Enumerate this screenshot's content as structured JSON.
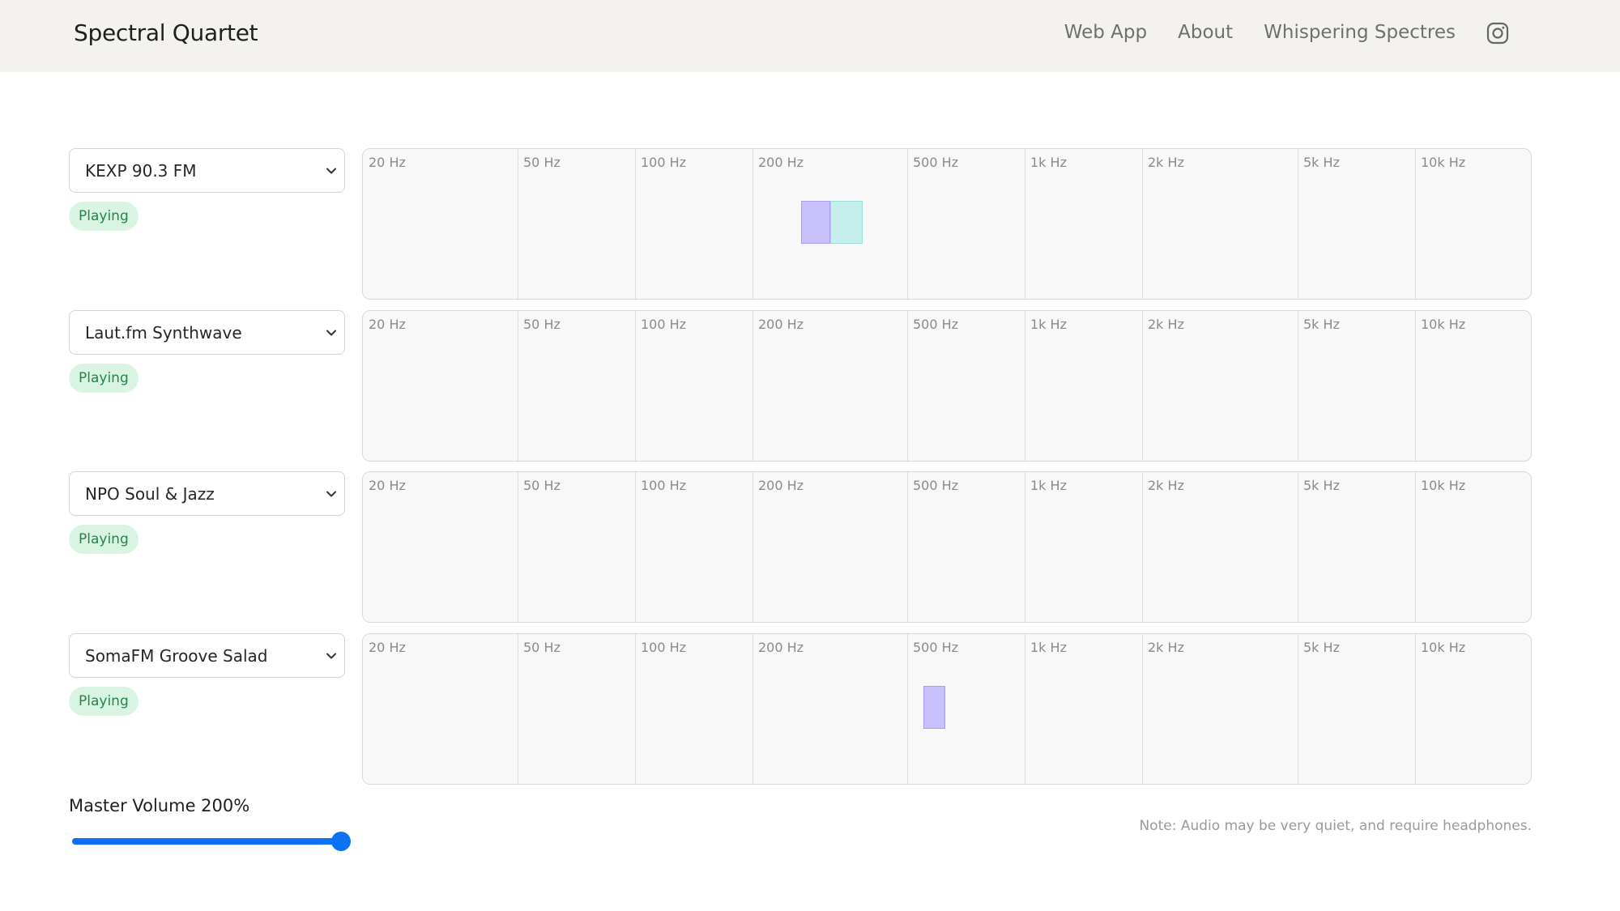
{
  "header": {
    "brand": "Spectral Quartet",
    "links": [
      "Web App",
      "About",
      "Whispering Spectres"
    ],
    "social_icon": "instagram-icon"
  },
  "frequency_labels": [
    "20 Hz",
    "50 Hz",
    "100 Hz",
    "200 Hz",
    "500 Hz",
    "1k Hz",
    "2k Hz",
    "5k Hz",
    "10k Hz"
  ],
  "channels": [
    {
      "station": "KEXP 90.3 FM",
      "status": "Playing",
      "bands": [
        {
          "color": "#c8c0fa",
          "border": "#a99cf4"
        },
        {
          "color": "#c6eeea",
          "border": "#96e0d8"
        }
      ]
    },
    {
      "station": "Laut.fm Synthwave",
      "status": "Playing",
      "bands": []
    },
    {
      "station": "NPO Soul & Jazz",
      "status": "Playing",
      "bands": []
    },
    {
      "station": "SomaFM Groove Salad",
      "status": "Playing",
      "bands": [
        {
          "color": "#c8c0fa",
          "border": "#a99cf4"
        }
      ]
    }
  ],
  "master_volume": {
    "label": "Master Volume 200%",
    "fraction": 1.0
  },
  "note": "Note: Audio may be very quiet, and require headphones.",
  "colors": {
    "accent": "#0c71f2",
    "status_bg": "#d9f4e3",
    "status_text": "#23864a",
    "header_bg": "#f3f2ef"
  }
}
